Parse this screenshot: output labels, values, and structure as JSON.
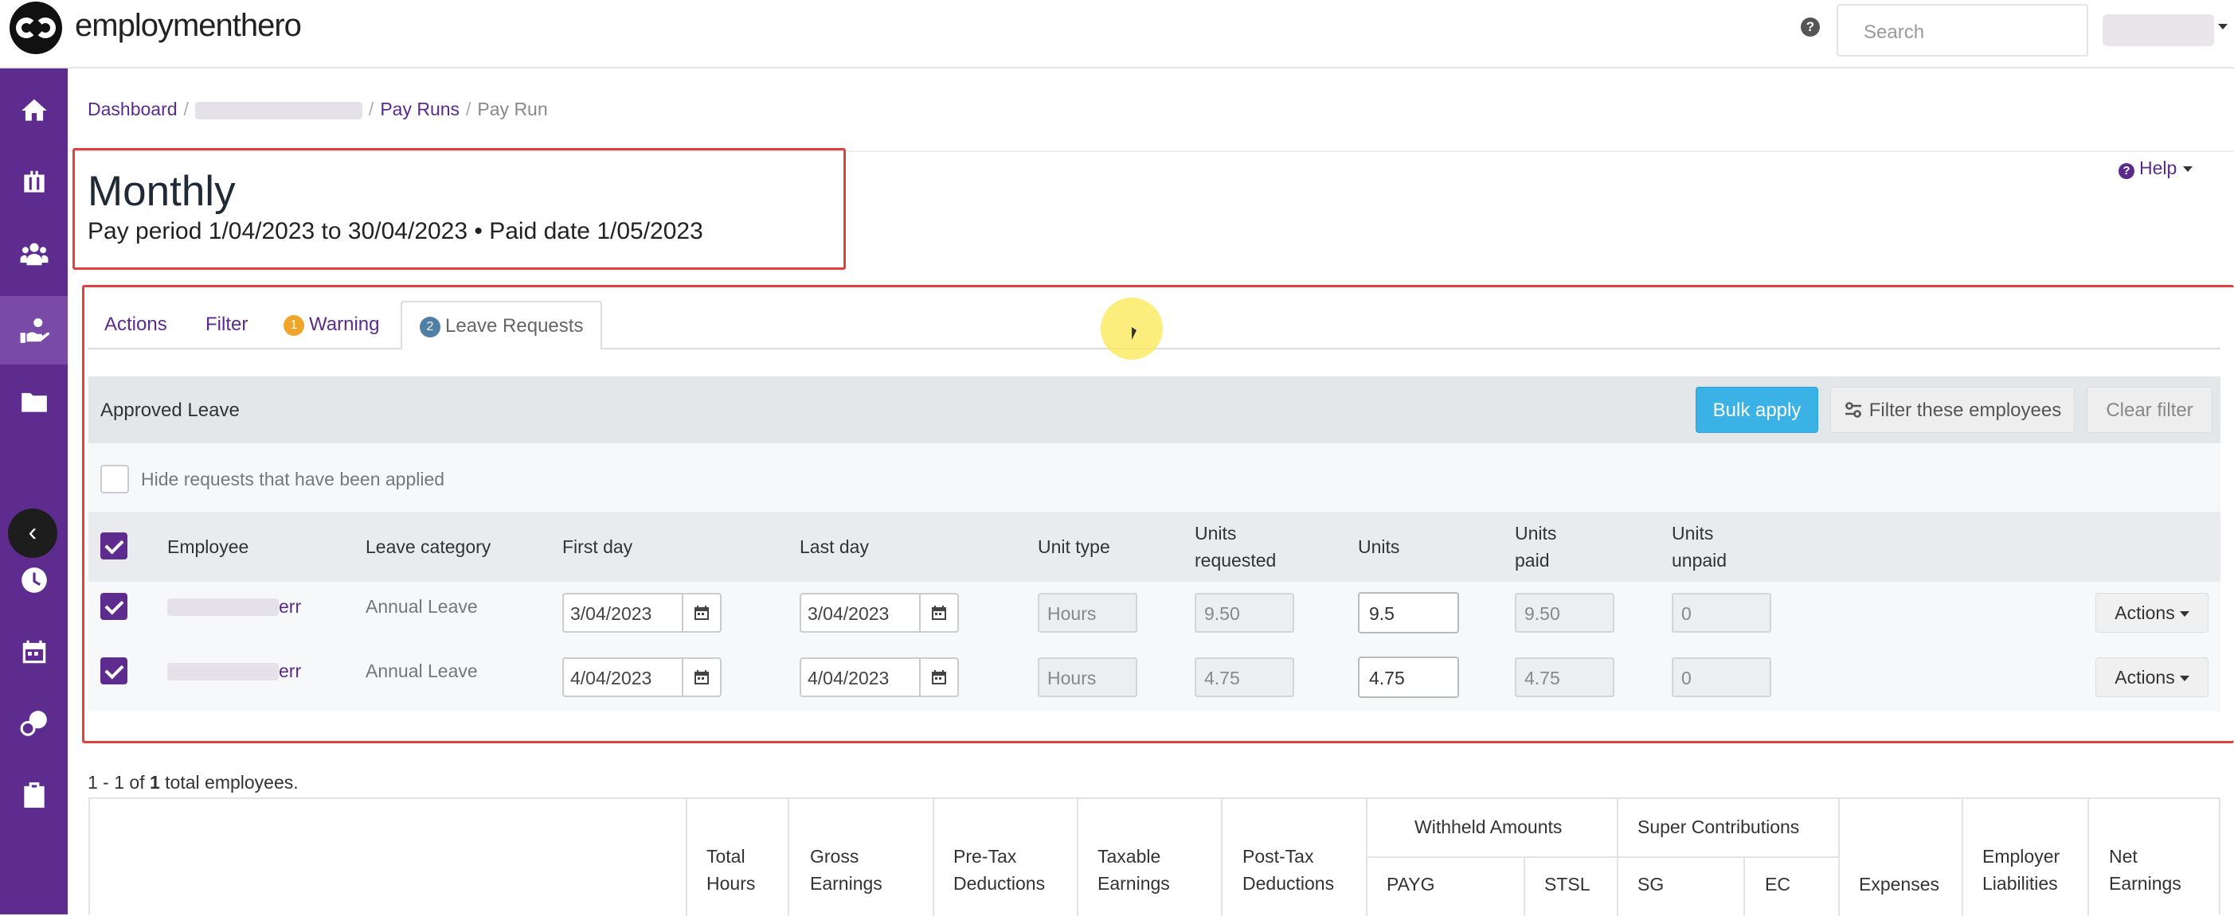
{
  "brand": {
    "name": "employmenthero"
  },
  "top_bar": {
    "help_glyph": "?",
    "search_placeholder": "Search"
  },
  "sidebar": {
    "items": [
      {
        "icon": "home-icon"
      },
      {
        "icon": "briefcase-icon"
      },
      {
        "icon": "people-icon"
      },
      {
        "icon": "payroll-hand-icon"
      },
      {
        "icon": "folder-icon"
      },
      {
        "icon": "clock-icon"
      },
      {
        "icon": "calendar-icon"
      },
      {
        "icon": "money-icon"
      },
      {
        "icon": "clipboard-icon"
      }
    ],
    "collapse_glyph": "‹"
  },
  "breadcrumb": {
    "dashboard": "Dashboard",
    "pay_runs": "Pay Runs",
    "current": "Pay Run",
    "sep": "/"
  },
  "header": {
    "title": "Monthly",
    "pay_period": "Pay period 1/04/2023 to 30/04/2023 • Paid date 1/05/2023",
    "help": "Help"
  },
  "tabs": {
    "actions": "Actions",
    "filter": "Filter",
    "warning": "Warning",
    "warning_count": "1",
    "leave_requests": "Leave Requests",
    "leave_count": "2"
  },
  "approved_leave": {
    "title": "Approved Leave",
    "bulk_apply": "Bulk apply",
    "filter_employees": "Filter these employees",
    "clear_filter": "Clear filter",
    "hide_applied": "Hide requests that have been applied",
    "columns": {
      "employee": "Employee",
      "leave_category": "Leave category",
      "first_day": "First day",
      "last_day": "Last day",
      "unit_type": "Unit type",
      "units_requested_1": "Units",
      "units_requested_2": "requested",
      "units": "Units",
      "units_paid_1": "Units",
      "units_paid_2": "paid",
      "units_unpaid_1": "Units",
      "units_unpaid_2": "unpaid"
    },
    "rows": [
      {
        "employee_suffix": "err",
        "leave_category": "Annual Leave",
        "first_day": "3/04/2023",
        "last_day": "3/04/2023",
        "unit_type": "Hours",
        "units_requested": "9.50",
        "units": "9.5",
        "units_paid": "9.50",
        "units_unpaid": "0",
        "actions": "Actions"
      },
      {
        "employee_suffix": "err",
        "leave_category": "Annual Leave",
        "first_day": "4/04/2023",
        "last_day": "4/04/2023",
        "unit_type": "Hours",
        "units_requested": "4.75",
        "units": "4.75",
        "units_paid": "4.75",
        "units_unpaid": "0",
        "actions": "Actions"
      }
    ]
  },
  "summary": {
    "total_prefix": "1 - 1 of ",
    "total_count": "1",
    "total_suffix": " total employees.",
    "headers": {
      "total_hours_1": "Total",
      "total_hours_2": "Hours",
      "gross_1": "Gross",
      "gross_2": "Earnings",
      "pretax_1": "Pre-Tax",
      "pretax_2": "Deductions",
      "taxable_1": "Taxable",
      "taxable_2": "Earnings",
      "posttax_1": "Post-Tax",
      "posttax_2": "Deductions",
      "withheld": "Withheld Amounts",
      "payg": "PAYG",
      "stsl": "STSL",
      "super": "Super Contributions",
      "sg": "SG",
      "ec": "EC",
      "expenses": "Expenses",
      "employer_1": "Employer",
      "employer_2": "Liabilities",
      "net_1": "Net",
      "net_2": "Earnings"
    }
  },
  "colors": {
    "sidebar": "#5e2b8f",
    "primary": "#3ab2e6",
    "link": "#5a2b8d",
    "highlight_box": "#e04040",
    "warning_badge": "#f0a52a",
    "info_badge": "#4f7fa5"
  }
}
